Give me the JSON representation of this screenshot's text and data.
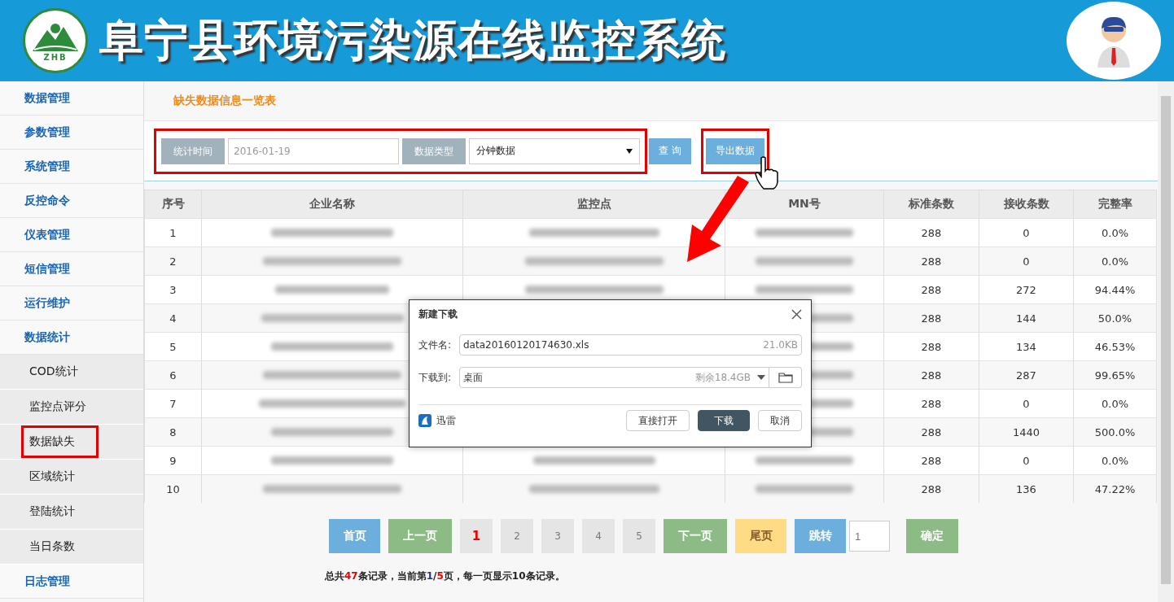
{
  "header": {
    "title": "阜宁县环境污染源在线监控系统",
    "logo_text": "ZHB"
  },
  "sidebar": {
    "items": [
      {
        "label": "数据管理",
        "kind": "group",
        "selected": false
      },
      {
        "label": "参数管理",
        "kind": "group",
        "selected": false
      },
      {
        "label": "系统管理",
        "kind": "group",
        "selected": false
      },
      {
        "label": "反控命令",
        "kind": "group",
        "selected": false
      },
      {
        "label": "仪表管理",
        "kind": "group",
        "selected": false
      },
      {
        "label": "短信管理",
        "kind": "group",
        "selected": false
      },
      {
        "label": "运行维护",
        "kind": "group",
        "selected": false
      },
      {
        "label": "数据统计",
        "kind": "group",
        "selected": false
      },
      {
        "label": "COD统计",
        "kind": "sub",
        "selected": false
      },
      {
        "label": "监控点评分",
        "kind": "sub",
        "selected": false
      },
      {
        "label": "数据缺失",
        "kind": "sub",
        "selected": true
      },
      {
        "label": "区域统计",
        "kind": "sub",
        "selected": false
      },
      {
        "label": "登陆统计",
        "kind": "sub",
        "selected": false
      },
      {
        "label": "当日条数",
        "kind": "sub",
        "selected": false
      },
      {
        "label": "日志管理",
        "kind": "group",
        "selected": false
      }
    ]
  },
  "page_title": "缺失数据信息一览表",
  "filters": {
    "time_label": "统计时间",
    "time_value": "2016-01-19",
    "type_label": "数据类型",
    "type_value": "分钟数据",
    "query_button": "查 询",
    "export_button": "导出数据"
  },
  "table": {
    "columns": [
      "序号",
      "企业名称",
      "监控点",
      "MN号",
      "标准条数",
      "接收条数",
      "完整率"
    ],
    "rows": [
      {
        "no": "1",
        "standard": "288",
        "received": "0",
        "rate": "0.0%"
      },
      {
        "no": "2",
        "standard": "288",
        "received": "0",
        "rate": "0.0%"
      },
      {
        "no": "3",
        "standard": "288",
        "received": "272",
        "rate": "94.44%"
      },
      {
        "no": "4",
        "standard": "288",
        "received": "144",
        "rate": "50.0%"
      },
      {
        "no": "5",
        "standard": "288",
        "received": "134",
        "rate": "46.53%"
      },
      {
        "no": "6",
        "standard": "288",
        "received": "287",
        "rate": "99.65%"
      },
      {
        "no": "7",
        "standard": "288",
        "received": "0",
        "rate": "0.0%"
      },
      {
        "no": "8",
        "standard": "288",
        "received": "1440",
        "rate": "500.0%"
      },
      {
        "no": "9",
        "standard": "288",
        "received": "0",
        "rate": "0.0%"
      },
      {
        "no": "10",
        "standard": "288",
        "received": "136",
        "rate": "47.22%"
      }
    ]
  },
  "pager": {
    "buttons": [
      {
        "label": "首页",
        "kind": "first"
      },
      {
        "label": "上一页",
        "kind": "prev"
      },
      {
        "label": "1",
        "kind": "page",
        "selected": true
      },
      {
        "label": "2",
        "kind": "page",
        "selected": false
      },
      {
        "label": "3",
        "kind": "page",
        "selected": false
      },
      {
        "label": "4",
        "kind": "page",
        "selected": false
      },
      {
        "label": "5",
        "kind": "page",
        "selected": false
      },
      {
        "label": "下一页",
        "kind": "next"
      },
      {
        "label": "尾页",
        "kind": "last"
      },
      {
        "label": "跳转",
        "kind": "jump"
      }
    ],
    "jump_placeholder": "1",
    "confirm": "确定"
  },
  "summary": [
    {
      "text": "总共",
      "kind": "plain"
    },
    {
      "text": "47",
      "kind": "red"
    },
    {
      "text": "条记录，当前第",
      "kind": "plain"
    },
    {
      "text": "1",
      "kind": "blue"
    },
    {
      "text": "/",
      "kind": "plain"
    },
    {
      "text": "5",
      "kind": "red"
    },
    {
      "text": "页，每一页显示10条记录。",
      "kind": "plain"
    }
  ],
  "dialog": {
    "title": "新建下载",
    "file_label": "文件名:",
    "file_name": "data20160120174630.xls",
    "file_size": "21.0KB",
    "dest_label": "下载到:",
    "dest": "桌面",
    "free_space": "剩余18.4GB",
    "brand": "迅雷",
    "open_button": "直接打开",
    "download_button": "下载",
    "cancel_button": "取消"
  }
}
